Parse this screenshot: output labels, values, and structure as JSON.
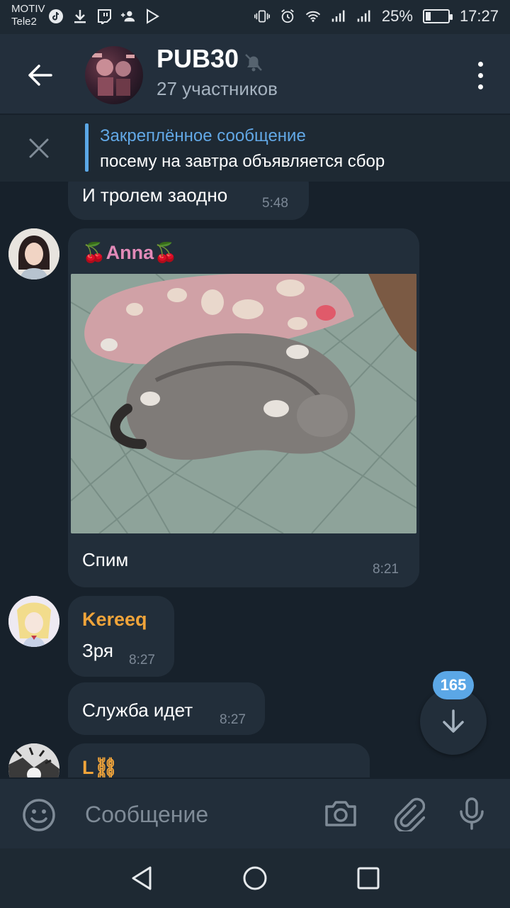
{
  "status_bar": {
    "carrier_1": "MOTIV",
    "carrier_2": "Tele2",
    "battery_percent": "25%",
    "battery_level": 0.25,
    "time": "17:27",
    "left_icons": [
      "tiktok-icon",
      "download-icon",
      "twitch-icon",
      "add-contact-icon",
      "play-store-icon"
    ],
    "right_icons": [
      "vibrate-icon",
      "alarm-icon",
      "wifi-icon",
      "signal-icon",
      "signal-icon"
    ]
  },
  "header": {
    "title": "PUB30",
    "subtitle": "27 участников",
    "muted": true
  },
  "pinned": {
    "title": "Закреплённое сообщение",
    "text": "посему на завтра объявляется сбор"
  },
  "messages": [
    {
      "text": "И тролем заодно",
      "time": "5:48"
    },
    {
      "sender": "🍒Anna🍒",
      "sender_color": "#e28ab8",
      "has_photo": true,
      "text": "Спим",
      "time": "8:21"
    },
    {
      "sender": "Kereeq",
      "sender_color": "#f0a43a",
      "text": "Зря",
      "time": "8:27"
    },
    {
      "text": "Служба идет",
      "time": "8:27"
    },
    {
      "sender": "L⛓",
      "sender_color": "#f0a43a"
    }
  ],
  "scroll_down": {
    "unread_count": "165"
  },
  "input": {
    "placeholder": "Сообщение"
  },
  "colors": {
    "background": "#17212b",
    "header": "#232f3c",
    "bubble": "#222e3a",
    "accent": "#5ba7e6"
  }
}
